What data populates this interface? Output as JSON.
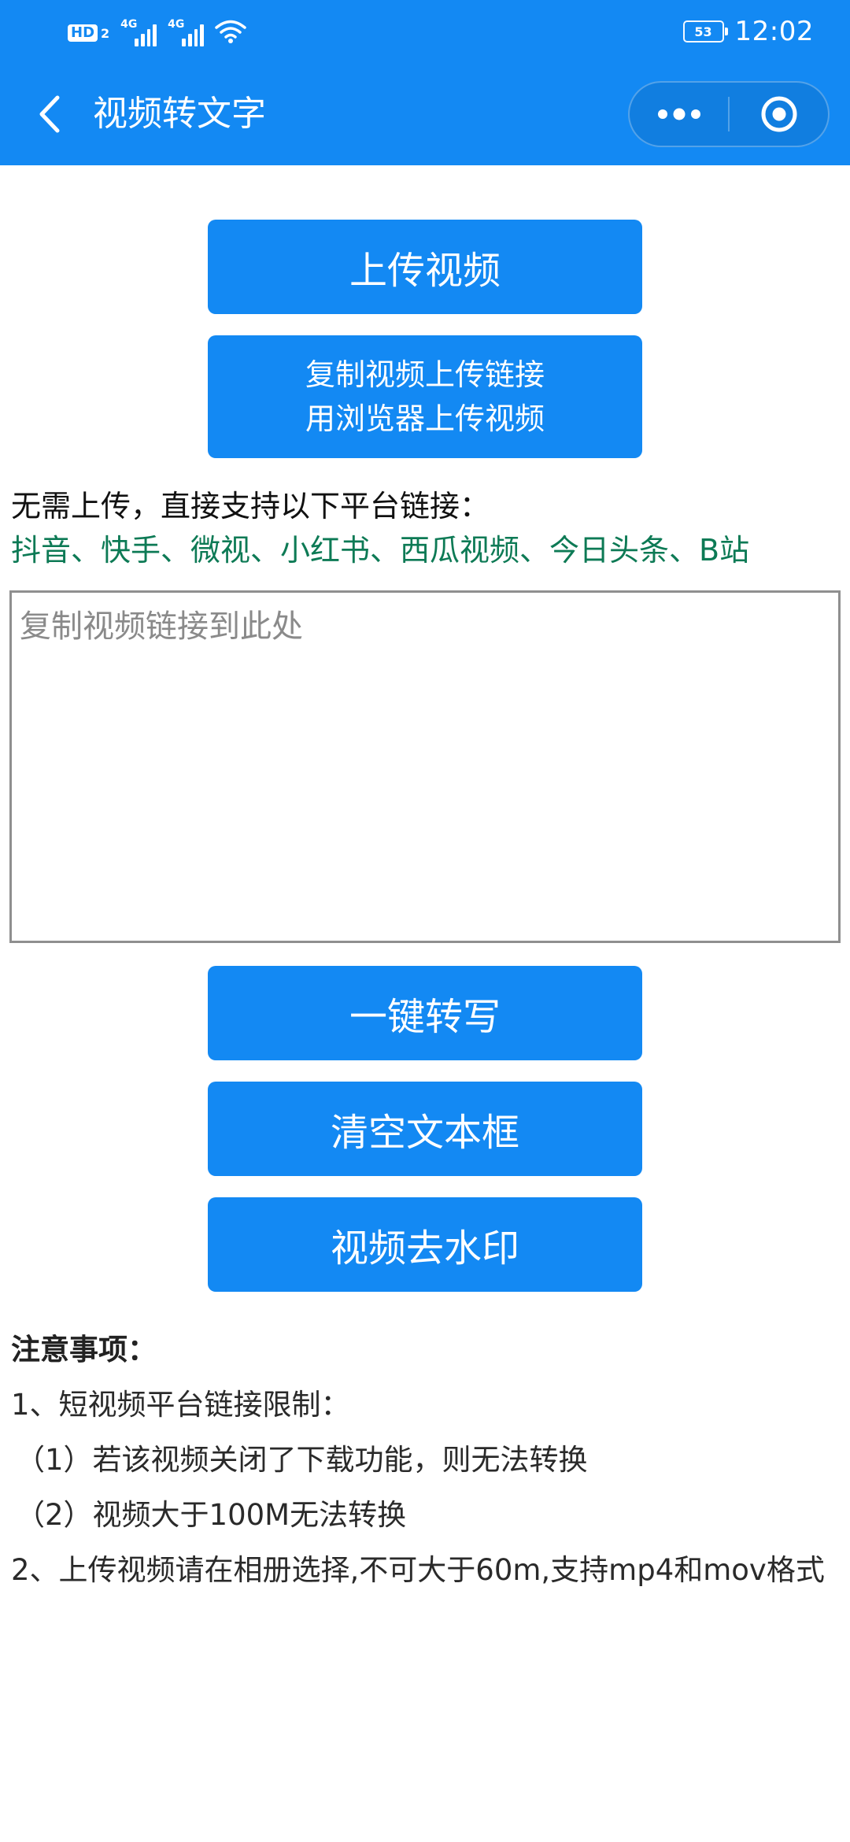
{
  "status_bar": {
    "hd": "HD",
    "hd_sub": "2",
    "net1": "4G",
    "net2": "4G",
    "battery": "53",
    "time": "12:02"
  },
  "nav": {
    "title": "视频转文字",
    "back_icon": "chevron-left-icon",
    "more_icon": "more-dots-icon",
    "close_icon": "target-circle-icon"
  },
  "buttons": {
    "upload": "上传视频",
    "copy_link_line1": "复制视频上传链接",
    "copy_link_line2": "用浏览器上传视频",
    "convert": "一键转写",
    "clear": "清空文本框",
    "remove_watermark": "视频去水印"
  },
  "info": {
    "no_upload": "无需上传，直接支持以下平台链接：",
    "platforms": "抖音、快手、微视、小红书、西瓜视频、今日头条、B站"
  },
  "link_input": {
    "placeholder": "复制视频链接到此处",
    "value": ""
  },
  "notes": {
    "title": "注意事项：",
    "item1": "1、短视频平台链接限制：",
    "item1_sub1": "（1）若该视频关闭了下载功能，则无法转换",
    "item1_sub2": "（2）视频大于100M无法转换",
    "item2": "2、上传视频请在相册选择,不可大于60m,支持mp4和mov格式"
  },
  "colors": {
    "primary": "#1389f3",
    "platform_text": "#0d7a55",
    "border": "#8f8f8f"
  }
}
